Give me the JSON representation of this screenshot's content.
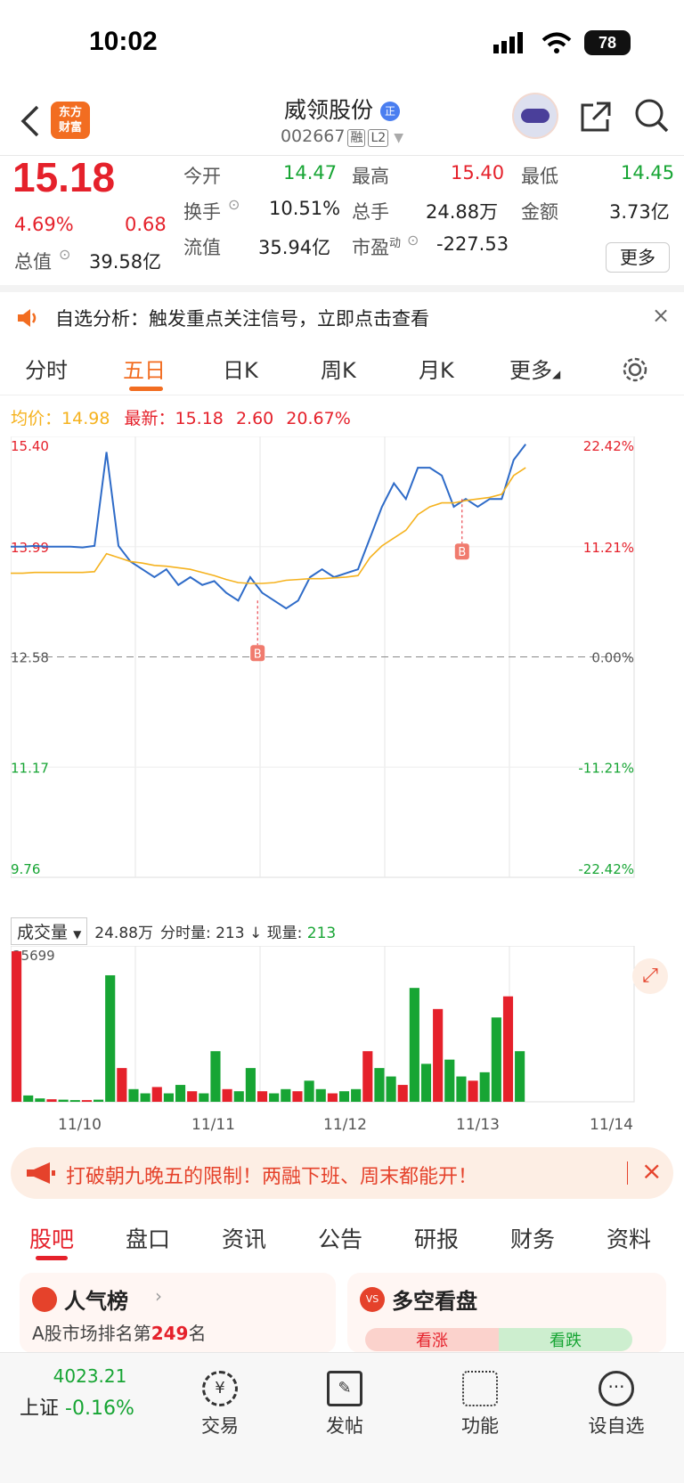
{
  "status_bar": {
    "time": "10:02",
    "battery": "78"
  },
  "header": {
    "logo_text": "东方\n财富",
    "stock_name": "威领股份",
    "code": "002667",
    "tag1": "融",
    "tag2": "L2"
  },
  "quote": {
    "price": "15.18",
    "change_pct": "4.69%",
    "change": "0.68",
    "open_label": "今开",
    "open": "14.47",
    "high_label": "最高",
    "high": "15.40",
    "low_label": "最低",
    "low": "14.45",
    "turnover_label": "换手",
    "turnover": "10.51%",
    "volume_label": "总手",
    "volume": "24.88万",
    "amount_label": "金额",
    "amount": "3.73亿",
    "mktcap_label": "总值",
    "mktcap": "39.58亿",
    "float_label": "流值",
    "float": "35.94亿",
    "pe_label": "市盈",
    "pe_sup": "动",
    "pe": "-227.53",
    "more": "更多"
  },
  "banner": {
    "text": "自选分析：触发重点关注信号，立即点击查看"
  },
  "tabs": [
    "分时",
    "五日",
    "日K",
    "周K",
    "月K",
    "更多"
  ],
  "active_tab": "五日",
  "legend": {
    "avg_label": "均价：",
    "avg": "14.98",
    "latest_label": "最新：",
    "latest": "15.18",
    "chg": "2.60",
    "pct": "20.67%"
  },
  "chart_data": {
    "type": "line",
    "title": "",
    "x": [
      "11/10",
      "11/11",
      "11/12",
      "11/13",
      "11/14"
    ],
    "y_ticks_left": [
      "15.40",
      "13.99",
      "12.58",
      "11.17",
      "9.76"
    ],
    "y_ticks_right": [
      "22.42%",
      "11.21%",
      "0.00%",
      "-11.21%",
      "-22.42%"
    ],
    "ylim": [
      9.76,
      15.4
    ],
    "baseline": 12.58,
    "series": [
      {
        "name": "",
        "color": "#2e6bc8",
        "values": [
          13.99,
          13.99,
          14.0,
          13.99,
          13.99,
          13.99,
          13.98,
          14.0,
          15.2,
          14.0,
          13.8,
          13.7,
          13.6,
          13.7,
          13.5,
          13.6,
          13.5,
          13.55,
          13.4,
          13.3,
          13.6,
          13.4,
          13.3,
          13.2,
          13.3,
          13.6,
          13.7,
          13.6,
          13.65,
          13.7,
          14.1,
          14.5,
          14.8,
          14.6,
          15.0,
          15.0,
          14.9,
          14.5,
          14.6,
          14.5,
          14.6,
          14.6,
          15.1,
          15.3
        ]
      },
      {
        "name": "",
        "color": "#f5b21e",
        "values": [
          13.65,
          13.65,
          13.66,
          13.66,
          13.66,
          13.66,
          13.66,
          13.67,
          13.9,
          13.85,
          13.8,
          13.78,
          13.75,
          13.74,
          13.72,
          13.7,
          13.66,
          13.62,
          13.57,
          13.53,
          13.52,
          13.52,
          13.53,
          13.56,
          13.57,
          13.58,
          13.58,
          13.59,
          13.6,
          13.62,
          13.85,
          14.0,
          14.1,
          14.2,
          14.4,
          14.5,
          14.55,
          14.55,
          14.58,
          14.6,
          14.62,
          14.66,
          14.9,
          15.0
        ]
      }
    ],
    "markers": [
      "B",
      "B"
    ],
    "volume_label": "成交量",
    "volume_total": "24.88万",
    "volume_info_label": "分时量: ",
    "volume_info": "213",
    "volume_now_label": "现量: ",
    "volume_now": "213",
    "volume_max": "35699",
    "volume": [
      35699,
      1500,
      800,
      600,
      500,
      400,
      400,
      500,
      30000,
      8000,
      3000,
      2000,
      3500,
      2000,
      4000,
      2500,
      2000,
      12000,
      3000,
      2500,
      8000,
      2500,
      2000,
      3000,
      2500,
      5000,
      3000,
      2000,
      2500,
      3000,
      12000,
      8000,
      6000,
      4000,
      27000,
      9000,
      22000,
      10000,
      6000,
      5000,
      7000,
      20000,
      25000,
      12000
    ]
  },
  "promo": {
    "text": "打破朝九晚五的限制！两融下班、周末都能开！"
  },
  "footer_tabs": [
    "股吧",
    "盘口",
    "资讯",
    "公告",
    "研报",
    "财务",
    "资料"
  ],
  "cards": {
    "left_title": "人气榜",
    "left_sub": "A股市场排名第",
    "rank": "249",
    "rank_suffix": "名",
    "right_title": "多空看盘",
    "bull": "看涨",
    "bear": "看跌"
  },
  "bottom_bar": {
    "index_value": "4023.21",
    "index_name": "上证",
    "index_change": "-0.16%",
    "items": [
      "交易",
      "发帖",
      "功能",
      "设自选"
    ]
  },
  "colors": {
    "red": "#e5212b",
    "green": "#17a534",
    "blue": "#2e6bc8",
    "orange": "#f5b21e",
    "accent": "#f26d21"
  }
}
